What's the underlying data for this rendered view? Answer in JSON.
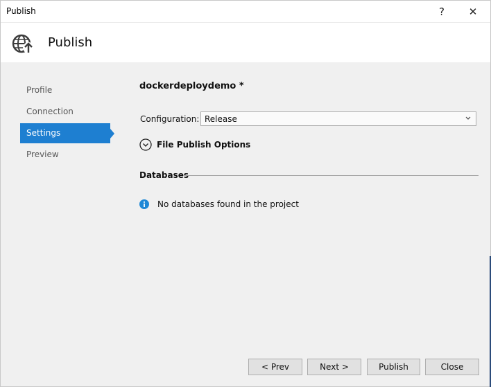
{
  "window": {
    "title": "Publish",
    "help_glyph": "?",
    "close_glyph": "✕"
  },
  "header": {
    "title": "Publish",
    "icon": "globe-publish-icon"
  },
  "nav": {
    "items": [
      {
        "label": "Profile"
      },
      {
        "label": "Connection"
      },
      {
        "label": "Settings",
        "active": true
      },
      {
        "label": "Preview"
      }
    ]
  },
  "settings": {
    "profile_name": "dockerdeploydemo *",
    "configuration_label": "Configuration:",
    "configuration_value": "Release",
    "file_publish_options_label": "File Publish Options"
  },
  "databases": {
    "header": "Databases",
    "message": "No databases found in the project"
  },
  "footer": {
    "prev_label": "< Prev",
    "next_label": "Next >",
    "publish_label": "Publish",
    "close_label": "Close"
  },
  "colors": {
    "accent": "#1e7fd1",
    "info": "#1e88d6"
  }
}
